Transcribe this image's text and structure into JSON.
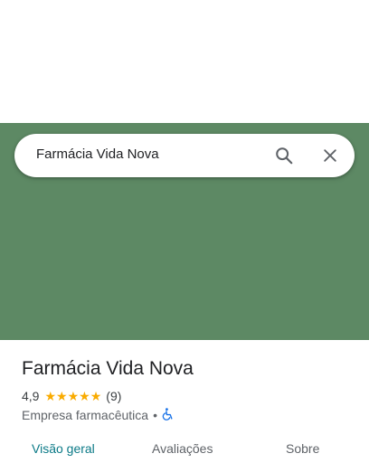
{
  "search": {
    "query": "Farmácia Vida Nova",
    "search_icon": "search-icon",
    "close_icon": "close-icon"
  },
  "place": {
    "name": "Farmácia Vida Nova",
    "rating": "4,9",
    "rating_value": 4.9,
    "stars": [
      "★",
      "★",
      "★",
      "★",
      "★"
    ],
    "review_count": "(9)",
    "category": "Empresa farmacêutica",
    "separator": "•",
    "accessibility_icon": "wheelchair-accessible-icon"
  },
  "tabs": [
    {
      "label": "Visão geral",
      "active": true
    },
    {
      "label": "Avaliações",
      "active": false
    },
    {
      "label": "Sobre",
      "active": false
    }
  ],
  "colors": {
    "map_green": "#5d8964",
    "star": "#f9ab00",
    "active_tab": "#0b7a87",
    "accessibility_blue": "#1a73e8"
  }
}
